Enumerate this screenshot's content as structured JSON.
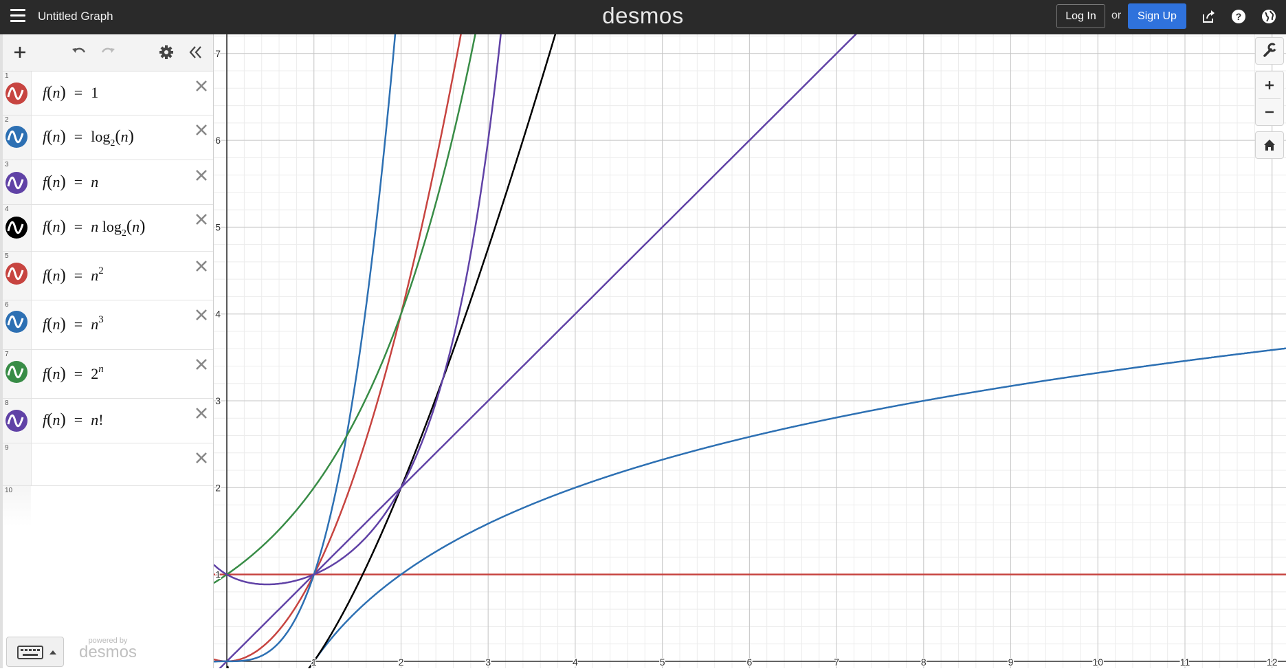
{
  "header": {
    "graph_title": "Untitled Graph",
    "brand": "desmos",
    "login_label": "Log In",
    "or_label": "or",
    "signup_label": "Sign Up"
  },
  "colors": {
    "red": "#c74440",
    "blue": "#2d70b3",
    "purple": "#6042a6",
    "black": "#000000",
    "green": "#388c46",
    "header_bg": "#2a2a2a",
    "signup_bg": "#2f72dc"
  },
  "toolbar": {
    "add_icon": "plus-icon",
    "undo_icon": "undo-icon",
    "redo_icon": "redo-icon",
    "settings_icon": "gear-icon",
    "collapse_icon": "double-chevron-left-icon"
  },
  "expressions": [
    {
      "num": "1",
      "color": "#c74440"
    },
    {
      "num": "2",
      "color": "#2d70b3"
    },
    {
      "num": "3",
      "color": "#6042a6"
    },
    {
      "num": "4",
      "color": "#000000"
    },
    {
      "num": "5",
      "color": "#c74440"
    },
    {
      "num": "6",
      "color": "#2d70b3"
    },
    {
      "num": "7",
      "color": "#388c46"
    },
    {
      "num": "8",
      "color": "#6042a6"
    },
    {
      "num": "9"
    },
    {
      "num": "10"
    }
  ],
  "math": {
    "f": "f",
    "lp": "(",
    "n": "n",
    "rp": ")",
    "eq": "=",
    "one": "1",
    "log": "log",
    "two": "2",
    "three": "3",
    "fact": "!"
  },
  "footer": {
    "keyboard_icon": "keyboard-icon",
    "powered_by": "powered by",
    "powered_brand": "desmos"
  },
  "graph": {
    "x_ticks": [
      "1",
      "2",
      "3",
      "4",
      "5",
      "6",
      "7",
      "8",
      "9",
      "10",
      "11",
      "12"
    ],
    "y_ticks": [
      "1",
      "2",
      "3",
      "4",
      "5",
      "6",
      "7"
    ],
    "x_range": [
      -0.15,
      12.16
    ],
    "y_range": [
      -0.08,
      7.22
    ],
    "controls": [
      "wrench-icon",
      "zoom-in-icon",
      "zoom-out-icon",
      "home-icon"
    ]
  },
  "chart_data": {
    "type": "line",
    "series": [
      {
        "formula": "1",
        "color": "#c74440"
      },
      {
        "formula": "log2(n)",
        "color": "#2d70b3"
      },
      {
        "formula": "n",
        "color": "#6042a6"
      },
      {
        "formula": "n log2(n)",
        "color": "#000000"
      },
      {
        "formula": "n^2",
        "color": "#c74440"
      },
      {
        "formula": "n^3",
        "color": "#2d70b3"
      },
      {
        "formula": "2^n",
        "color": "#388c46"
      },
      {
        "formula": "n!",
        "color": "#6042a6"
      }
    ],
    "xlim": [
      -0.15,
      12.16
    ],
    "ylim": [
      -0.08,
      7.22
    ],
    "grid": true
  }
}
